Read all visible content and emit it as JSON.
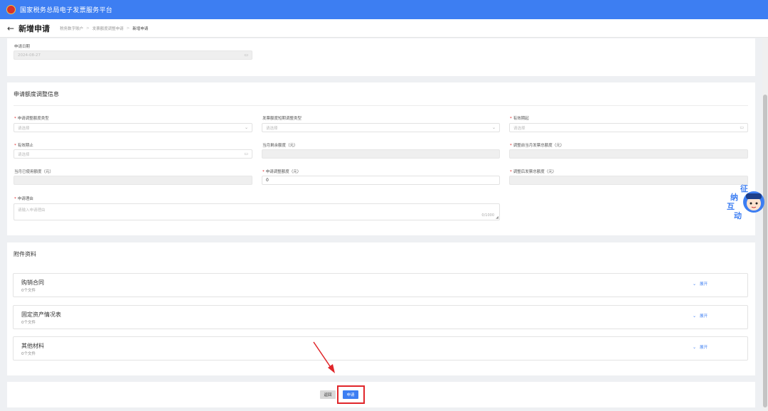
{
  "app": {
    "title": "国家税务总局电子发票服务平台"
  },
  "header": {
    "back_icon": "left-arrow-icon",
    "page_title": "新增申请",
    "breadcrumb": [
      "税务数字账户",
      "发票额度调整申请",
      "新增申请"
    ]
  },
  "basic": {
    "apply_date": {
      "label": "申请日期",
      "value": "2024-08-27",
      "icon": "calendar-icon"
    }
  },
  "quota": {
    "section_title": "申请额度调整信息",
    "fields": {
      "adjust_type": {
        "label": "申请调整额度类型",
        "placeholder": "请选择",
        "required": true
      },
      "short_term_type": {
        "label": "发票额度短期调整类型",
        "placeholder": "请选择",
        "required": false
      },
      "valid_from": {
        "label": "有效期起",
        "placeholder": "请选择",
        "required": true
      },
      "valid_to": {
        "label": "有效期止",
        "placeholder": "请选择",
        "required": true
      },
      "remaining": {
        "label": "当月剩余额度（元）",
        "value": ""
      },
      "total_before": {
        "label": "调整前当月发票总额度（元）",
        "value": ""
      },
      "used": {
        "label": "当月已使用额度（元）",
        "value": ""
      },
      "adjust_amount": {
        "label": "申请调整额度（元）",
        "value": "0",
        "required": true
      },
      "total_after": {
        "label": "调整后发票总额度（元）",
        "value": ""
      },
      "reason": {
        "label": "申请理由",
        "placeholder": "请输入申请理由",
        "counter": "0/1000",
        "required": true
      }
    }
  },
  "attachments": {
    "section_title": "附件资料",
    "items": [
      {
        "name": "购销合同",
        "count": "0个文件",
        "expand": "展开"
      },
      {
        "name": "固定资产情况表",
        "count": "0个文件",
        "expand": "展开"
      },
      {
        "name": "其他材料",
        "count": "0个文件",
        "expand": "展开"
      }
    ]
  },
  "actions": {
    "back": "返回",
    "submit": "申请"
  },
  "assistant": {
    "label_lines": [
      "征",
      "纳",
      "互",
      "动"
    ]
  },
  "colors": {
    "brand": "#3d7ef2",
    "annotation": "#e0262a",
    "required": "#e02020"
  }
}
